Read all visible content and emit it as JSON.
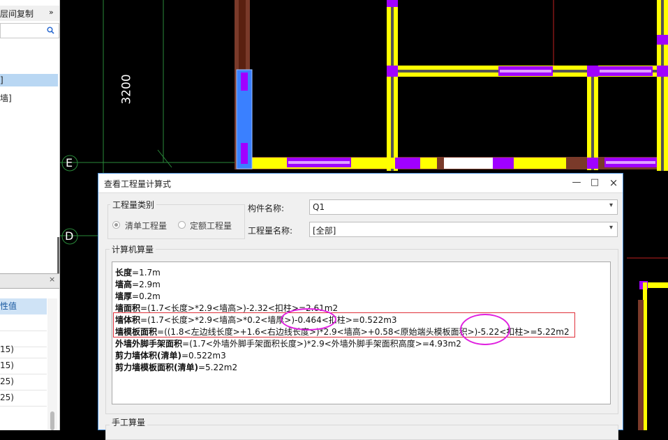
{
  "left_panel": {
    "toolbar_label": "层间复制",
    "toolbar_arrow": "»",
    "tree_items": [
      "]",
      "墙]"
    ],
    "prop_close": "×",
    "prop_header": "性值",
    "prop_rows": [
      "15)",
      "15)",
      "25)",
      "25)"
    ]
  },
  "cad": {
    "dim_text": "3200",
    "axis_e": "E",
    "axis_d": "D",
    "colors": {
      "wall_yellow": "#ffff00",
      "column_purple": "#a000ff",
      "selected_blue": "#3a80ff",
      "grid_green": "#2a8a3a"
    }
  },
  "dialog": {
    "title": "查看工程量计算式",
    "min_label": "—",
    "max_label": "□",
    "close_label": "×",
    "qty_type_group": {
      "title": "工程量类别",
      "option1": "清单工程量",
      "option2": "定额工程量",
      "selected": "清单工程量"
    },
    "component_name_label": "构件名称:",
    "component_name_value": "Q1",
    "qty_name_label": "工程量名称:",
    "qty_name_value": "[全部]",
    "computer_calc_title": "计算机算量",
    "lines": [
      {
        "name": "长度",
        "expr": "=1.7m"
      },
      {
        "name": "墙高",
        "expr": "=2.9m"
      },
      {
        "name": "墙厚",
        "expr": "=0.2m"
      },
      {
        "name": "墙面积",
        "expr": "=(1.7<长度>*2.9<墙高>)-2.32<扣柱>=2.61m2"
      },
      {
        "name": "墙体积",
        "expr": "=(1.7<长度>*2.9<墙高>*0.2<墙厚>)-0.464<扣柱>=0.522m3"
      },
      {
        "name": "墙模板面积",
        "expr": "=((1.8<左边线长度>+1.6<右边线长度>)*2.9<墙高>+0.58<原始端头模板面积>)-5.22<扣柱>=5.22m2"
      },
      {
        "name": "外墙外脚手架面积",
        "expr": "=(1.7<外墙外脚手架面积长度>)*2.9<外墙外脚手架面积高度>=4.93m2"
      },
      {
        "name": "剪力墙体积(清单)",
        "expr": "=0.522m3"
      },
      {
        "name": "剪力墙模板面积(清单)",
        "expr": "=5.22m2"
      }
    ],
    "manual_calc_title": "手工算量",
    "combo_arrow": "▾"
  }
}
